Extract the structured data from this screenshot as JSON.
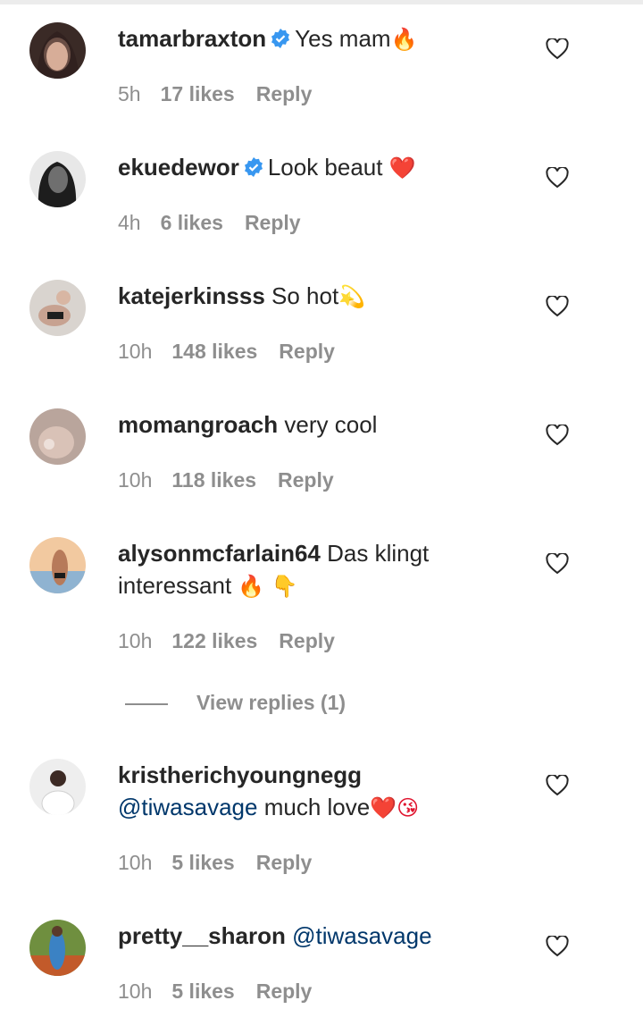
{
  "comments": [
    {
      "username": "tamarbraxton",
      "verified": true,
      "text": "Yes mam",
      "emoji": "🔥",
      "time": "5h",
      "likes": "17 likes",
      "reply": "Reply"
    },
    {
      "username": "ekuedewor",
      "verified": true,
      "text": "Look beaut ",
      "emoji": "❤️",
      "time": "4h",
      "likes": "6 likes",
      "reply": "Reply"
    },
    {
      "username": "katejerkinsss",
      "verified": false,
      "text": "So hot",
      "emoji": "💫",
      "time": "10h",
      "likes": "148 likes",
      "reply": "Reply"
    },
    {
      "username": "momangroach",
      "verified": false,
      "text": "very cool",
      "emoji": "",
      "time": "10h",
      "likes": "118 likes",
      "reply": "Reply"
    },
    {
      "username": "alysonmcfarlain64",
      "verified": false,
      "text": "Das klingt",
      "text2": "interessant ",
      "emoji": "🔥 👇",
      "time": "10h",
      "likes": "122 likes",
      "reply": "Reply"
    },
    {
      "username": "kristherichyoungnegg",
      "verified": false,
      "mention": "@tiwasavage",
      "text": " much love",
      "emoji": "❤️😘",
      "time": "10h",
      "likes": "5 likes",
      "reply": "Reply"
    },
    {
      "username": "pretty__sharon",
      "verified": false,
      "mention": "@tiwasavage",
      "text": "",
      "emoji": "",
      "time": "10h",
      "likes": "5 likes",
      "reply": "Reply"
    }
  ],
  "view_replies": "View replies (1)",
  "colors": {
    "verified": "#3897f0",
    "mention": "#00376b",
    "meta": "#8e8e8e"
  }
}
